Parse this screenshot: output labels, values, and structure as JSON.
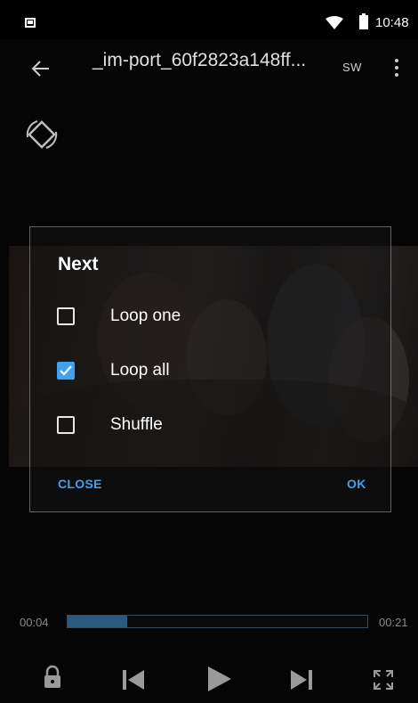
{
  "status_bar": {
    "time": "10:48"
  },
  "header": {
    "title": "_im-port_60f2823a148ff...",
    "sw_label": "SW"
  },
  "dialog": {
    "title": "Next",
    "options": [
      {
        "label": "Loop one",
        "checked": false
      },
      {
        "label": "Loop all",
        "checked": true
      },
      {
        "label": "Shuffle",
        "checked": false
      }
    ],
    "close_label": "CLOSE",
    "ok_label": "OK"
  },
  "player": {
    "current_time": "00:04",
    "total_time": "00:21",
    "progress": 0.2
  },
  "colors": {
    "accent": "#3ea2f0",
    "background": "#050505"
  },
  "icons": {
    "back": "arrow-left",
    "more": "vertical-dots",
    "rotate": "screen-rotation",
    "lock": "padlock",
    "previous": "skip-previous",
    "play": "play",
    "next": "skip-next",
    "fullscreen": "expand-arrows"
  }
}
